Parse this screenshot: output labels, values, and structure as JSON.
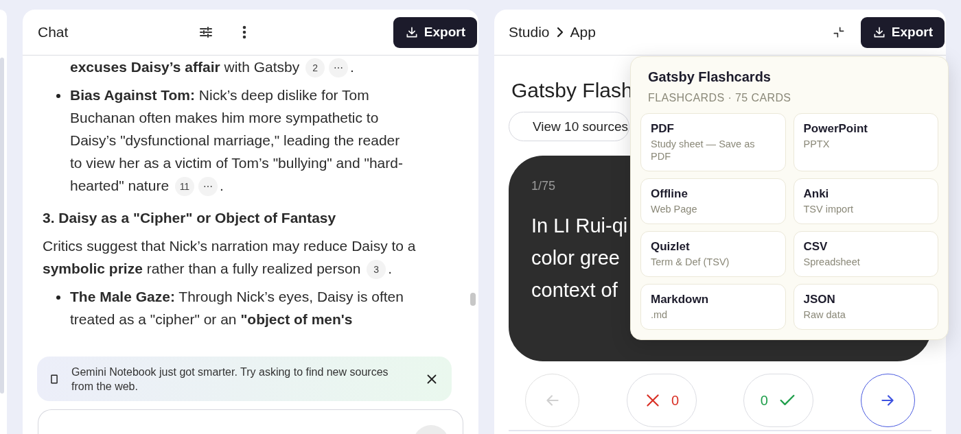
{
  "chat": {
    "title": "Chat",
    "export_label": "Export",
    "blocks": [
      {
        "kind": "continuation",
        "text": "**excuses Daisy’s affair** with Gatsby",
        "citations": [
          "2",
          "⋯"
        ],
        "end": "."
      },
      {
        "kind": "bullet",
        "text": "**Bias Against Tom:** Nick’s deep dislike for Tom Buchanan often makes him more sympathetic to Daisy’s \"dysfunctional marriage,\" leading the reader to view her as a victim of Tom’s \"bullying\" and \"hard-hearted\" nature",
        "citations": [
          "11",
          "⋯"
        ],
        "end": "."
      },
      {
        "kind": "heading",
        "text": "3. Daisy as a \"Cipher\" or Object of Fantasy"
      },
      {
        "kind": "paragraph",
        "text": "Critics suggest that Nick’s narration may reduce Daisy to a **symbolic prize** rather than a fully realized person",
        "citations": [
          "3"
        ],
        "end": "."
      },
      {
        "kind": "bullet",
        "text": "**The Male Gaze:** Through Nick’s eyes, Daisy is often treated as a \"cipher\" or an **\"object of men's**"
      }
    ],
    "banner": {
      "text": "Gemini Notebook just got smarter. Try asking to find new sources from the web."
    }
  },
  "studio": {
    "breadcrumb": [
      "Studio",
      "App"
    ],
    "export_label": "Export",
    "title": "Gatsby Flash",
    "sources_button": "View 10 sources",
    "card": {
      "counter": "1/75",
      "lines": [
        "In LI Rui-qi",
        "color gree",
        "context of"
      ]
    },
    "controls": [
      {
        "kind": "back",
        "disabled": true
      },
      {
        "kind": "wrong",
        "count": "0",
        "disabled": false
      },
      {
        "kind": "right",
        "count": "0",
        "disabled": false
      },
      {
        "kind": "next",
        "disabled": false
      }
    ]
  },
  "export_menu": {
    "title": "Gatsby Flashcards",
    "subtitle": "FLASHCARDS · 75 CARDS",
    "options": [
      {
        "name": "PDF",
        "description": "Study sheet — Save as PDF"
      },
      {
        "name": "PowerPoint",
        "description": "PPTX"
      },
      {
        "name": "Offline",
        "description": "Web Page"
      },
      {
        "name": "Anki",
        "description": "TSV import"
      },
      {
        "name": "Quizlet",
        "description": "Term & Def (TSV)"
      },
      {
        "name": "CSV",
        "description": "Spreadsheet"
      },
      {
        "name": "Markdown",
        "description": ".md"
      },
      {
        "name": "JSON",
        "description": "Raw data"
      }
    ]
  }
}
